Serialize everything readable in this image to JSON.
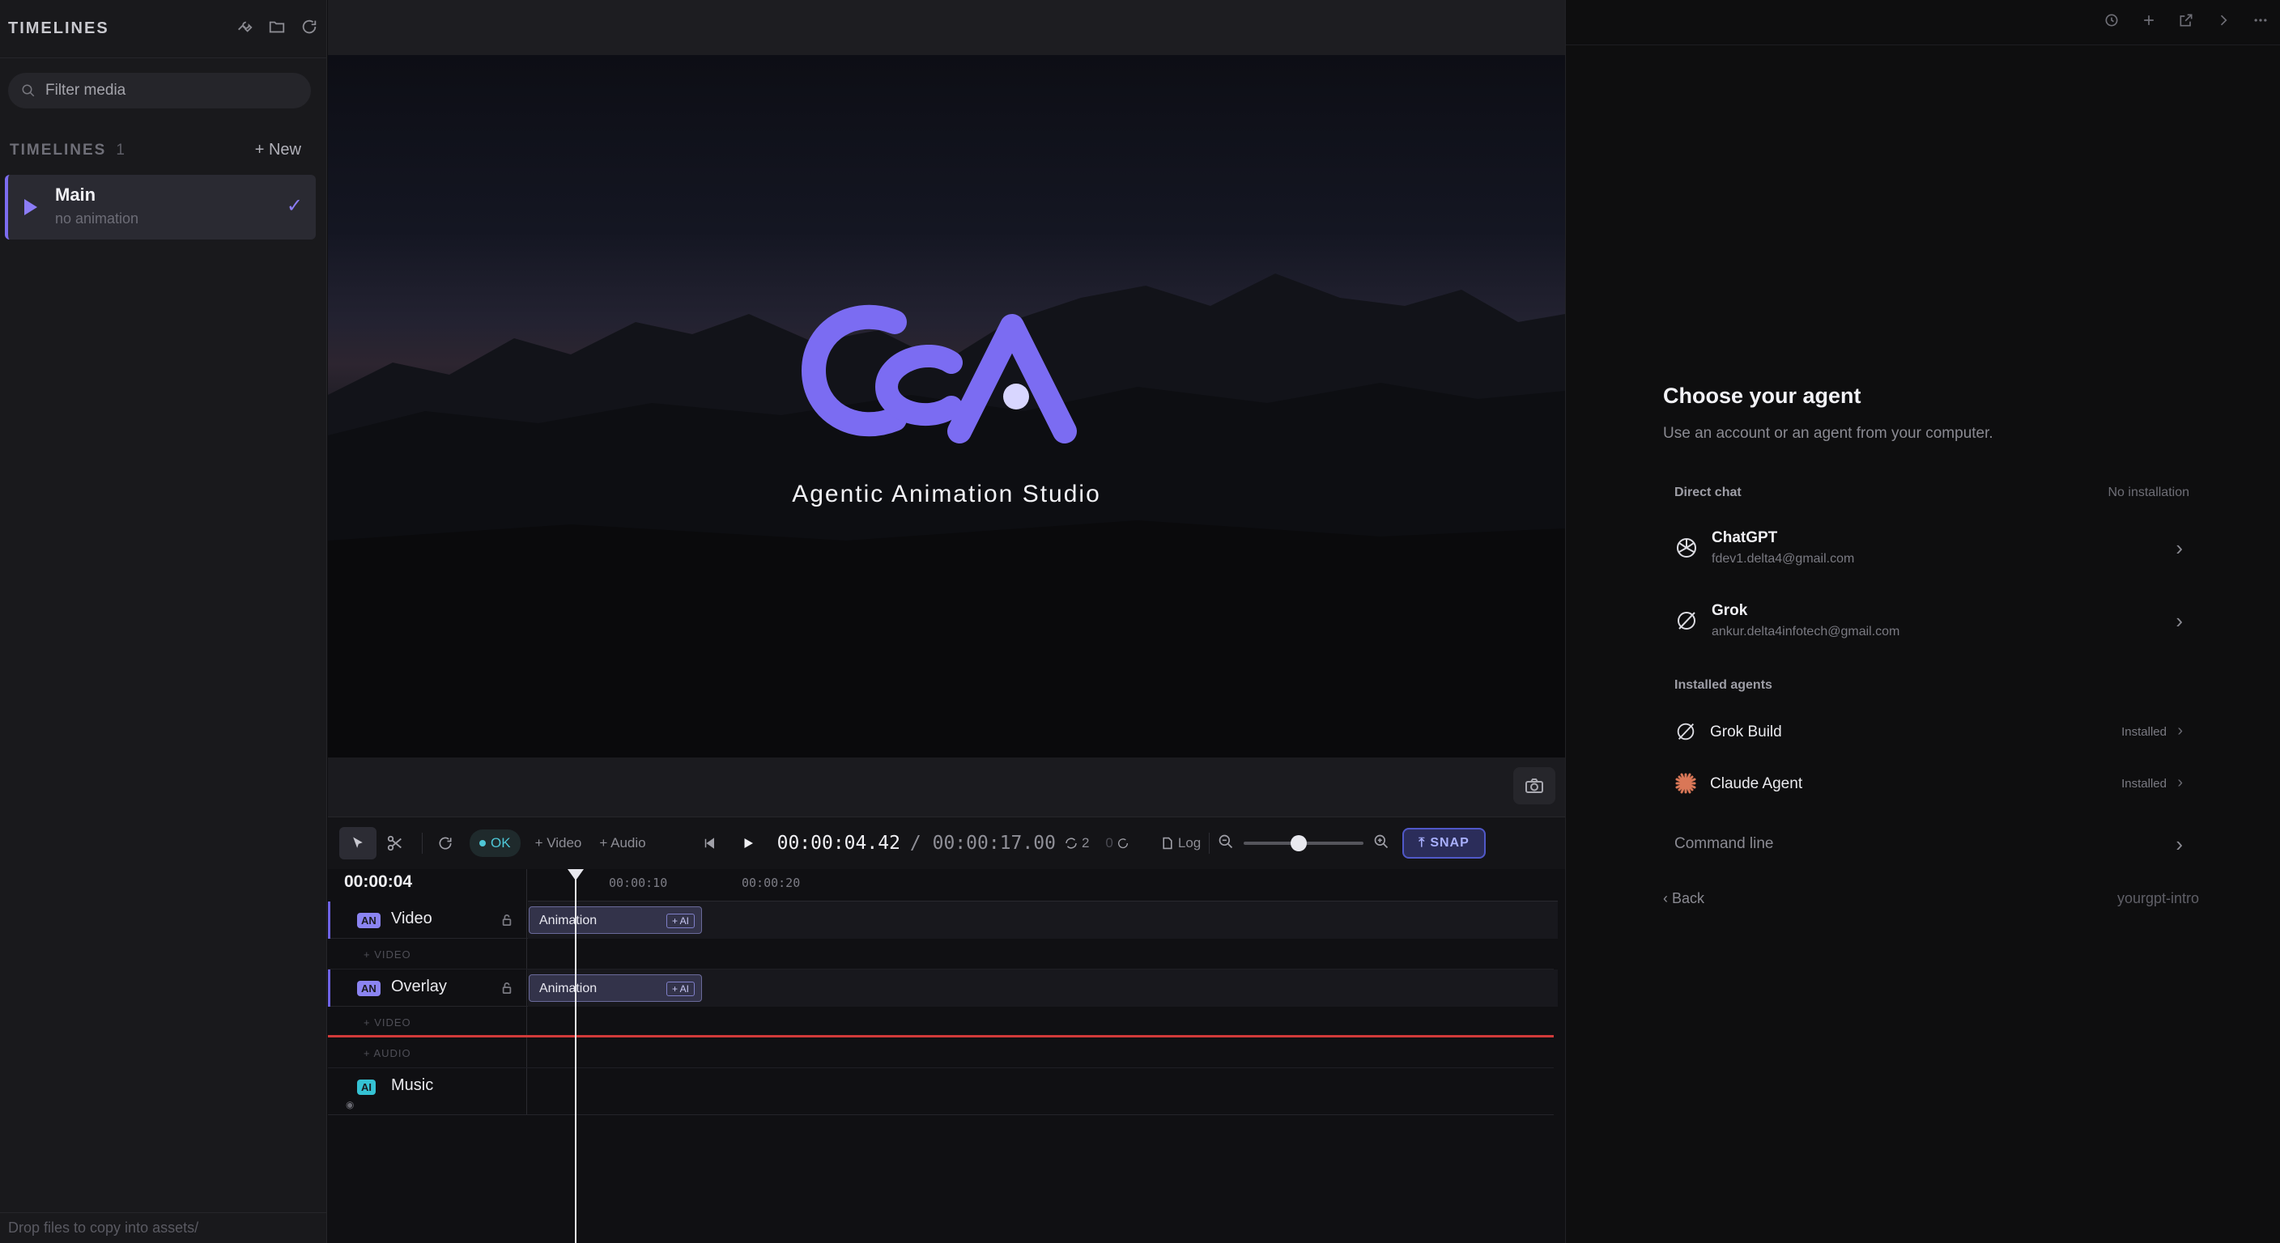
{
  "sidebar": {
    "title": "TIMELINES",
    "search_placeholder": "Filter media",
    "section_label": "TIMELINES",
    "section_count": "1",
    "new_label": "+ New",
    "items": [
      {
        "name": "Main",
        "subtitle": "no animation",
        "selected": true
      }
    ],
    "footer": "Drop files to copy into assets/"
  },
  "preview": {
    "studio_text": "Agentic Animation Studio",
    "logo_text": "CcA"
  },
  "toolbar": {
    "status": "OK",
    "add_video": "+ Video",
    "add_audio": "+ Audio",
    "current_time": "00:00:04.42",
    "total_time": "/ 00:00:17.00",
    "loop_count": "2",
    "redo_count": "0",
    "log_label": "Log",
    "zoom_level": 0.25,
    "snap_label": "SNAP"
  },
  "timeline": {
    "current_time": "00:00:04",
    "ruler_marks": [
      "00:00:10",
      "00:00:20"
    ],
    "tracks": [
      {
        "badge": "AN",
        "name": "Video",
        "clip": "Animation",
        "clip_tag": "+ AI"
      },
      {
        "badge": "AN",
        "name": "Overlay",
        "clip": "Animation",
        "clip_tag": "+ AI"
      },
      {
        "badge": "AI",
        "name": "Music"
      }
    ],
    "add_video_label": "+ VIDEO",
    "add_audio_label": "+ AUDIO"
  },
  "agent_panel": {
    "title": "Choose your agent",
    "subtitle": "Use an account or an agent from your computer.",
    "direct_chat_label": "Direct chat",
    "no_install_label": "No installation",
    "direct_chats": [
      {
        "name": "ChatGPT",
        "email": "fdev1.delta4@gmail.com",
        "icon": "openai-icon"
      },
      {
        "name": "Grok",
        "email": "ankur.delta4infotech@gmail.com",
        "icon": "grok-icon"
      }
    ],
    "installed_label": "Installed agents",
    "installed": [
      {
        "name": "Grok Build",
        "status": "Installed",
        "icon": "grok-icon"
      },
      {
        "name": "Claude Agent",
        "status": "Installed",
        "icon": "claude-icon"
      }
    ],
    "command_line_label": "Command line",
    "back_label": "‹ Back",
    "repo_label": "yourgpt-intro"
  },
  "colors": {
    "accent": "#7c6cf0",
    "snap_border": "#5058c8",
    "ok_text": "#4ec6d6",
    "playhead_red": "#d13a3a",
    "claude": "#d97757"
  }
}
